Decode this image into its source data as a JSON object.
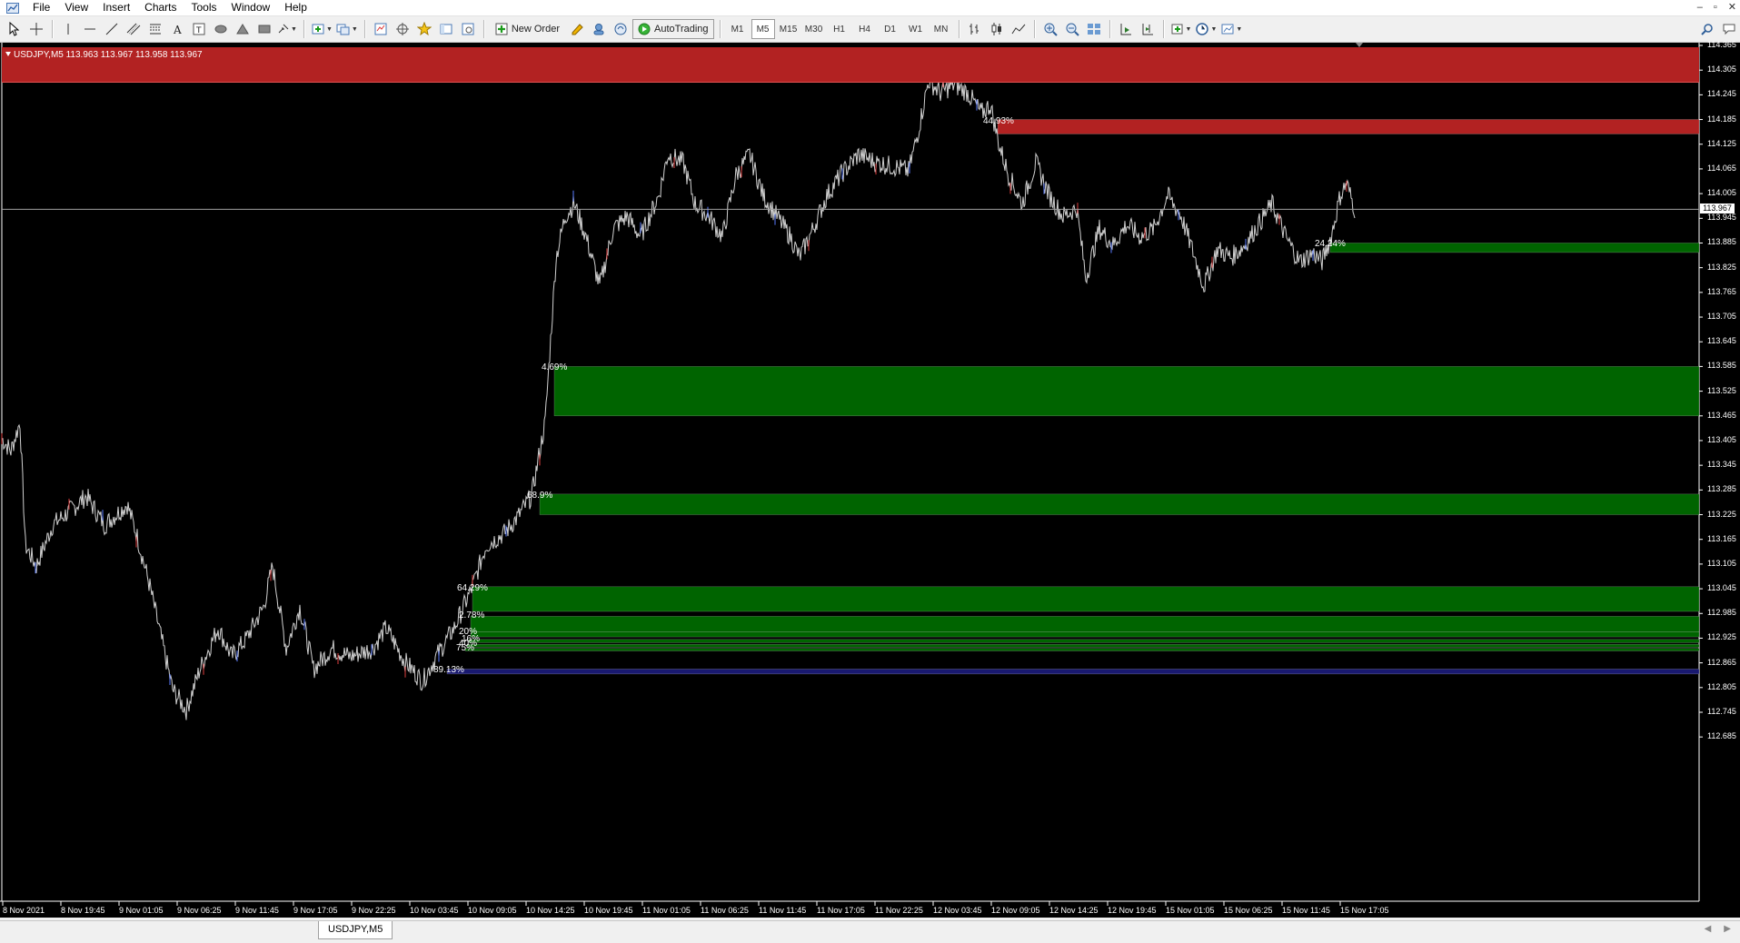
{
  "menu": {
    "items": [
      "File",
      "View",
      "Insert",
      "Charts",
      "Tools",
      "Window",
      "Help"
    ]
  },
  "window_controls": [
    "–",
    "▫",
    "✕"
  ],
  "toolbar": {
    "new_order": "New Order",
    "autotrading": "AutoTrading",
    "timeframes": [
      "M1",
      "M5",
      "M15",
      "M30",
      "H1",
      "H4",
      "D1",
      "W1",
      "MN"
    ],
    "active_timeframe": "M5"
  },
  "chart": {
    "info": "USDJPY,M5  113.963 113.967 113.958 113.967",
    "bid": "113.967",
    "price_ticks": [
      "114.365",
      "114.305",
      "114.245",
      "114.185",
      "114.125",
      "114.065",
      "114.005",
      "113.945",
      "113.885",
      "113.825",
      "113.765",
      "113.705",
      "113.645",
      "113.585",
      "113.525",
      "113.465",
      "113.405",
      "113.345",
      "113.285",
      "113.225",
      "113.165",
      "113.105",
      "113.045",
      "112.985",
      "112.925",
      "112.865",
      "112.805",
      "112.745",
      "112.685"
    ],
    "time_ticks": [
      "8 Nov 2021",
      "8 Nov 19:45",
      "9 Nov 01:05",
      "9 Nov 06:25",
      "9 Nov 11:45",
      "9 Nov 17:05",
      "9 Nov 22:25",
      "10 Nov 03:45",
      "10 Nov 09:05",
      "10 Nov 14:25",
      "10 Nov 19:45",
      "11 Nov 01:05",
      "11 Nov 06:25",
      "11 Nov 11:45",
      "11 Nov 17:05",
      "11 Nov 22:25",
      "12 Nov 03:45",
      "12 Nov 09:05",
      "12 Nov 14:25",
      "12 Nov 19:45",
      "15 Nov 01:05",
      "15 Nov 06:25",
      "15 Nov 11:45",
      "15 Nov 17:05"
    ],
    "zones": [
      {
        "type": "supply",
        "label": "44.93%",
        "from": 114.185,
        "to": 114.15
      },
      {
        "type": "demand",
        "label": "24.24%",
        "from": 113.885,
        "to": 113.862
      },
      {
        "type": "demand",
        "label": "4.69%",
        "from": 113.585,
        "to": 113.465
      },
      {
        "type": "demand",
        "label": "68.9%",
        "from": 113.275,
        "to": 113.225
      },
      {
        "type": "demand",
        "label": "64.29%",
        "from": 113.05,
        "to": 112.99
      },
      {
        "type": "demand",
        "label": "2.78%",
        "from": 112.978,
        "to": 112.94
      },
      {
        "type": "demand",
        "label": "20%",
        "from": 112.94,
        "to": 112.928
      },
      {
        "type": "demand",
        "label": "16%",
        "from": 112.922,
        "to": 112.914
      },
      {
        "type": "demand",
        "label": "40%",
        "from": 112.91,
        "to": 112.903
      },
      {
        "type": "demand",
        "label": "75%",
        "from": 112.9,
        "to": 112.894
      },
      {
        "type": "demand-strong",
        "label": "89.13%",
        "from": 112.85,
        "to": 112.838
      }
    ],
    "colors": {
      "supply": "#b22222",
      "demand": "#006400",
      "demand_strong": "#191970",
      "bullish_wick": "#5a7cff",
      "bearish_wick": "#e04040",
      "price": "#d0d0d0"
    }
  },
  "tabs": {
    "active": "USDJPY,M5"
  }
}
